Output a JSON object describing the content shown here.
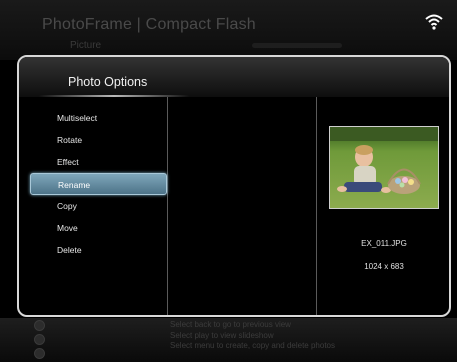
{
  "app": {
    "title": "PhotoFrame | Compact Flash",
    "subtitle": "Picture"
  },
  "dialog": {
    "title": "Photo Options",
    "menu": [
      {
        "label": "Multiselect",
        "selected": false
      },
      {
        "label": "Rotate",
        "selected": false
      },
      {
        "label": "Effect",
        "selected": false
      },
      {
        "label": "Rename",
        "selected": true
      },
      {
        "label": "Copy",
        "selected": false
      },
      {
        "label": "Move",
        "selected": false
      },
      {
        "label": "Delete",
        "selected": false
      }
    ],
    "file": {
      "name": "EX_011.JPG",
      "dimensions": "1024 x 683"
    }
  },
  "footer": {
    "hints": [
      "Select back to go to previous view",
      "Select play to view slideshow",
      "Select menu to create, copy and delete photos"
    ]
  },
  "colors": {
    "selected_item": "#5f8aa0",
    "dialog_border": "#d8d8d8"
  },
  "icons": [
    "wifi-icon",
    "back-icon",
    "play-icon",
    "menu-icon"
  ]
}
